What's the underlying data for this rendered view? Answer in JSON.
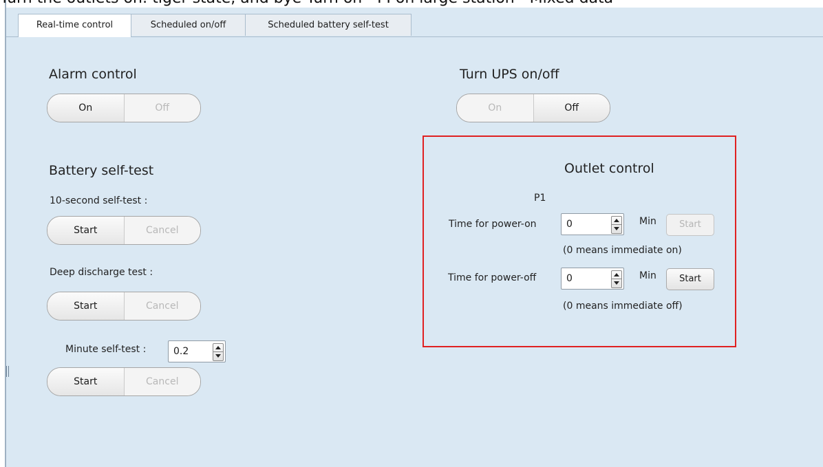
{
  "overlay_caption": "Turn the outlets on: tiger state, and bye Turn on - PI on large station - Mixed data",
  "tabs": [
    {
      "label": "Real-time control",
      "active": true
    },
    {
      "label": "Scheduled on/off",
      "active": false
    },
    {
      "label": "Scheduled battery self-test",
      "active": false
    }
  ],
  "alarm_control": {
    "title": "Alarm control",
    "on_label": "On",
    "off_label": "Off",
    "selected": "On"
  },
  "ups_power": {
    "title": "Turn UPS on/off",
    "on_label": "On",
    "off_label": "Off",
    "selected": "Off"
  },
  "battery_self_test": {
    "title": "Battery self-test",
    "ten_second": {
      "label": "10-second self-test :",
      "start_label": "Start",
      "cancel_label": "Cancel"
    },
    "deep_discharge": {
      "label": "Deep discharge test :",
      "start_label": "Start",
      "cancel_label": "Cancel"
    },
    "minute": {
      "label": "Minute self-test :",
      "value": "0.2",
      "start_label": "Start",
      "cancel_label": "Cancel"
    }
  },
  "outlet_control": {
    "title": "Outlet control",
    "outlet_name": "P1",
    "power_on": {
      "label": "Time for power-on",
      "value": "0",
      "unit": "Min",
      "start_label": "Start",
      "note": "(0 means immediate on)"
    },
    "power_off": {
      "label": "Time for power-off",
      "value": "0",
      "unit": "Min",
      "start_label": "Start",
      "note": "(0 means immediate off)"
    }
  },
  "colors": {
    "panel_bg": "#dae8f3",
    "highlight_box": "#e02020"
  }
}
